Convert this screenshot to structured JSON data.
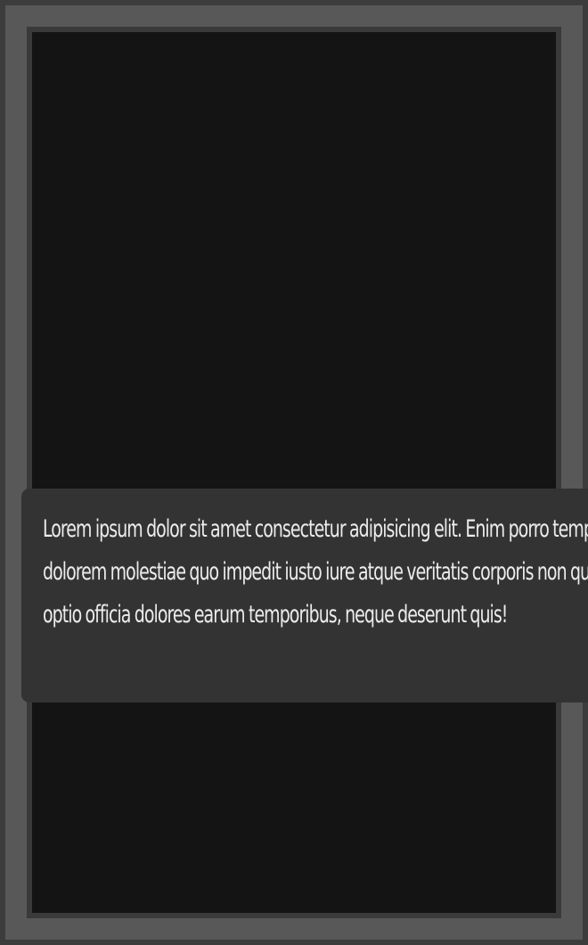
{
  "card": {
    "text": "Lorem ipsum dolor sit amet consectetur adipisicing elit. Enim porro tempore dolorem molestiae quo impedit iusto iure atque veritatis corporis non quae optio officia dolores earum temporibus, neque deserunt quis!"
  },
  "colors": {
    "outer": "#3c3c3c",
    "border": "#585858",
    "screen": "#141414",
    "card": "#333333",
    "text": "#ececec"
  }
}
